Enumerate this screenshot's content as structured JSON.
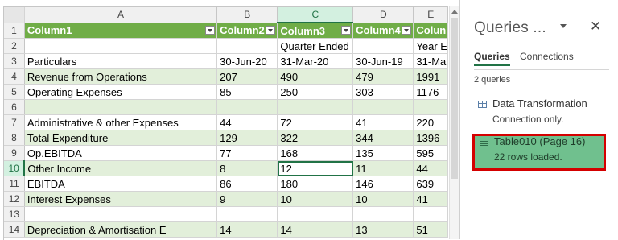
{
  "sheet": {
    "columns": [
      "A",
      "B",
      "C",
      "D",
      "E"
    ],
    "rows": [
      {
        "num": "1",
        "style": "header",
        "cells": [
          "Column1",
          "Column2",
          "Column3",
          "Column4",
          "Colun"
        ]
      },
      {
        "num": "2",
        "style": "",
        "cells": [
          "",
          "",
          "Quarter Ended",
          "",
          "Year E"
        ]
      },
      {
        "num": "3",
        "style": "",
        "cells": [
          "Particulars",
          "30-Jun-20",
          "31-Mar-20",
          "30-Jun-19",
          "31-Ma"
        ]
      },
      {
        "num": "4",
        "style": "band",
        "cells": [
          "Revenue from Operations",
          "207",
          "490",
          "479",
          "1991"
        ]
      },
      {
        "num": "5",
        "style": "",
        "cells": [
          "Operating Expenses",
          "85",
          "250",
          "303",
          "1176"
        ]
      },
      {
        "num": "6",
        "style": "band",
        "cells": [
          "",
          "",
          "",
          "",
          ""
        ]
      },
      {
        "num": "7",
        "style": "",
        "cells": [
          "Administrative & other Expenses",
          "44",
          "72",
          "41",
          "220"
        ]
      },
      {
        "num": "8",
        "style": "band",
        "cells": [
          "Total Expenditure",
          "129",
          "322",
          "344",
          "1396"
        ]
      },
      {
        "num": "9",
        "style": "",
        "cells": [
          "Op.EBITDA",
          "77",
          "168",
          "135",
          "595"
        ]
      },
      {
        "num": "10",
        "style": "band",
        "cells": [
          "Other Income",
          "8",
          "12",
          "11",
          "44"
        ]
      },
      {
        "num": "11",
        "style": "",
        "cells": [
          "EBITDA",
          "86",
          "180",
          "146",
          "639"
        ]
      },
      {
        "num": "12",
        "style": "band",
        "cells": [
          "Interest Expenses",
          "9",
          "10",
          "10",
          "41"
        ]
      },
      {
        "num": "13",
        "style": "",
        "cells": [
          "",
          "",
          "",
          "",
          ""
        ]
      },
      {
        "num": "14",
        "style": "band",
        "cells": [
          "Depreciation & Amortisation E",
          "14",
          "14",
          "13",
          "51"
        ]
      }
    ],
    "active_cell": {
      "row": "10",
      "column": "C"
    }
  },
  "queries_pane": {
    "title": "Queries ...",
    "close_glyph": "✕",
    "tabs": [
      "Queries",
      "Connections"
    ],
    "count_text": "2 queries",
    "items": [
      {
        "name": "Data Transformation",
        "status": "Connection only."
      },
      {
        "name": "Table010 (Page 16)",
        "status": "22 rows loaded."
      }
    ],
    "highlight_color": "#70c08e",
    "highlight_border": "#d40000"
  },
  "colors": {
    "table_header": "#70ad47",
    "band": "#e2efda",
    "accent": "#217346"
  }
}
